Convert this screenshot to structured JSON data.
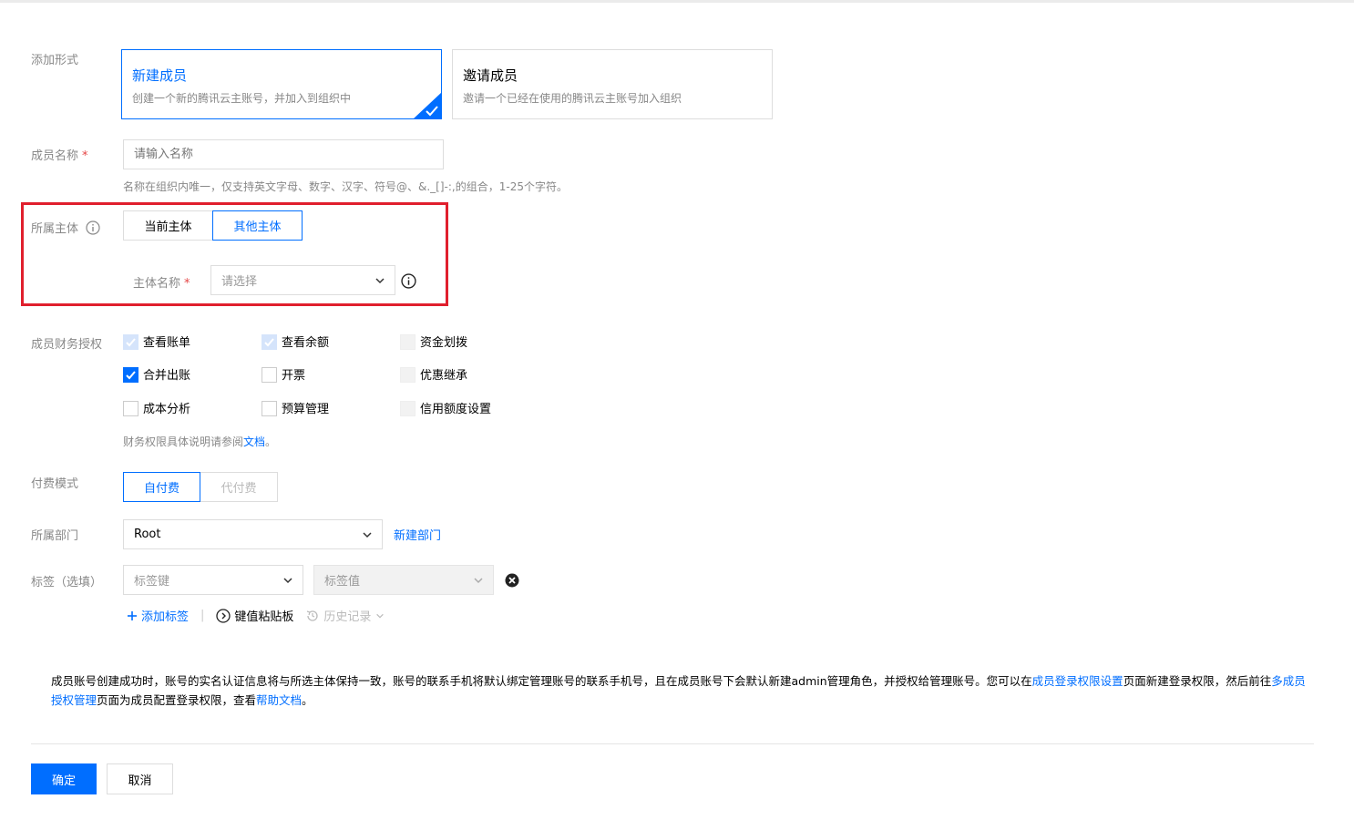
{
  "add_mode": {
    "label": "添加形式",
    "options": [
      {
        "title": "新建成员",
        "desc": "创建一个新的腾讯云主账号，并加入到组织中",
        "selected": true
      },
      {
        "title": "邀请成员",
        "desc": "邀请一个已经在使用的腾讯云主账号加入组织",
        "selected": false
      }
    ]
  },
  "member_name": {
    "label": "成员名称",
    "required_mark": "*",
    "placeholder": "请输入名称",
    "value": "",
    "hint": "名称在组织内唯一，仅支持英文字母、数字、汉字、符号@、&._[]-:,的组合，1-25个字符。"
  },
  "entity": {
    "label": "所属主体",
    "info_icon": "info-icon",
    "options": [
      "当前主体",
      "其他主体"
    ],
    "selected": "其他主体",
    "entity_name_label": "主体名称",
    "entity_name_required": "*",
    "entity_name_placeholder": "请选择"
  },
  "finance": {
    "label": "成员财务授权",
    "permissions": [
      {
        "label": "查看账单",
        "state": "checked-disabled"
      },
      {
        "label": "查看余额",
        "state": "checked-disabled"
      },
      {
        "label": "资金划拨",
        "state": "disabled"
      },
      {
        "label": "合并出账",
        "state": "checked"
      },
      {
        "label": "开票",
        "state": "unchecked"
      },
      {
        "label": "优惠继承",
        "state": "disabled"
      },
      {
        "label": "成本分析",
        "state": "unchecked"
      },
      {
        "label": "预算管理",
        "state": "unchecked"
      },
      {
        "label": "信用额度设置",
        "state": "disabled"
      }
    ],
    "hint_prefix": "财务权限具体说明请参阅",
    "hint_link": "文档",
    "hint_suffix": "。"
  },
  "pay_mode": {
    "label": "付费模式",
    "options": [
      "自付费",
      "代付费"
    ],
    "selected": "自付费"
  },
  "department": {
    "label": "所属部门",
    "value": "Root",
    "new_link": "新建部门"
  },
  "tags": {
    "label": "标签（选填）",
    "key_placeholder": "标签键",
    "value_placeholder": "标签值",
    "add_label": "添加标签",
    "paste_label": "键值粘贴板",
    "history_label": "历史记录",
    "separator": "|"
  },
  "notice": {
    "part1": "成员账号创建成功时，账号的实名认证信息将与所选主体保持一致，账号的联系手机将默认绑定管理账号的联系手机号，且在成员账号下会默认新建admin管理角色，并授权给管理账号。您可以在",
    "link1": "成员登录权限设置",
    "part2": "页面新建登录权限，然后前往",
    "link2": "多成员授权管理",
    "part3": "页面为成员配置登录权限，查看",
    "link3": "帮助文档",
    "part4": "。"
  },
  "footer": {
    "confirm": "确定",
    "cancel": "取消"
  },
  "colors": {
    "primary": "#006eff",
    "highlight_border": "#e01f2d",
    "required": "#e54545"
  }
}
